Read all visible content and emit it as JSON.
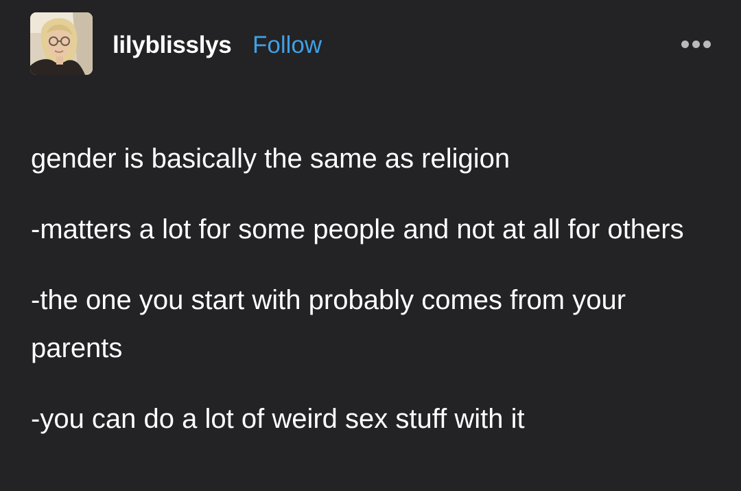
{
  "post": {
    "username": "lilyblisslys",
    "follow_label": "Follow",
    "more_icon": "ellipsis-horizontal-icon",
    "paragraphs": [
      "gender is basically the same as religion",
      "-matters a lot for some people and not at all for others",
      "-the one you start with probably comes from your parents",
      "-you can do a lot of weird sex stuff with it"
    ]
  },
  "colors": {
    "background": "#232224",
    "text": "#ffffff",
    "follow": "#3ea1e6",
    "more_icon": "#b9b9bb"
  }
}
